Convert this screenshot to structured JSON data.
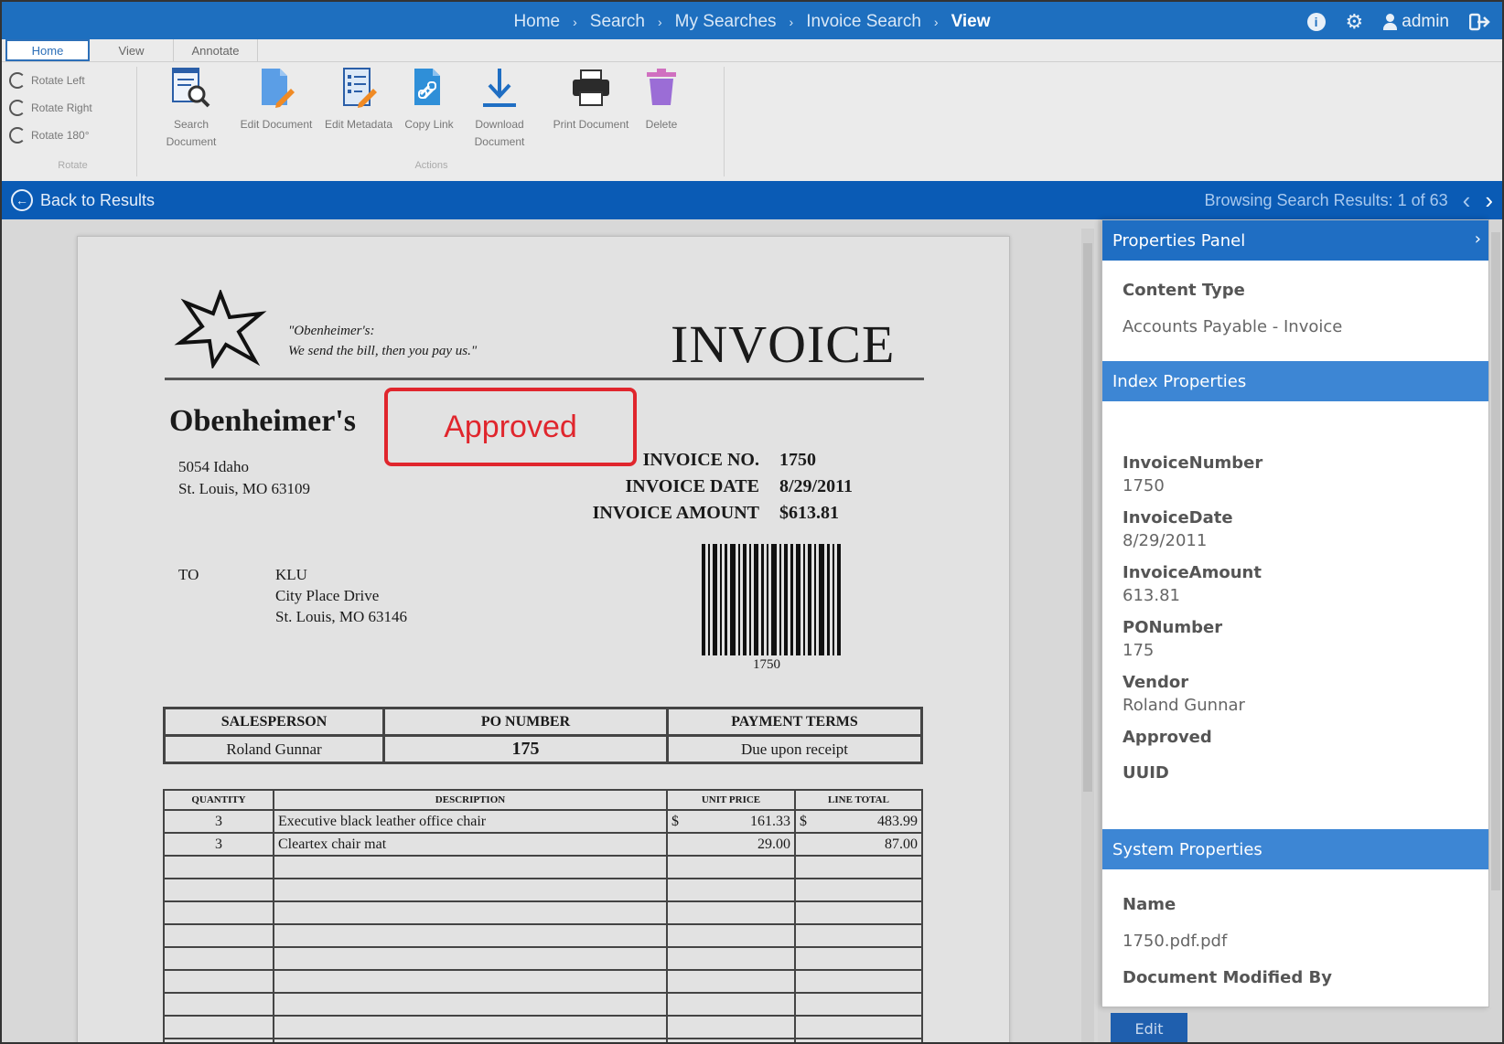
{
  "breadcrumbs": {
    "items": [
      "Home",
      "Search",
      "My Searches",
      "Invoice Search"
    ],
    "current": "View"
  },
  "topbar": {
    "user": "admin",
    "icons": [
      "info-icon",
      "gear-icon",
      "user-icon",
      "logout-icon"
    ]
  },
  "ribbon": {
    "tabs": [
      "Home",
      "View",
      "Annotate"
    ],
    "active_tab": "Home",
    "rotate": {
      "items": [
        "Rotate Left",
        "Rotate Right",
        "Rotate 180°"
      ],
      "label": "Rotate"
    },
    "actions": {
      "label": "Actions",
      "items": [
        {
          "line1": "Search",
          "line2": "Document"
        },
        {
          "line1": "Edit Document",
          "line2": ""
        },
        {
          "line1": "Edit Metadata",
          "line2": ""
        },
        {
          "line1": "Copy Link",
          "line2": ""
        },
        {
          "line1": "Download",
          "line2": "Document"
        },
        {
          "line1": "Print Document",
          "line2": ""
        },
        {
          "line1": "Delete",
          "line2": ""
        }
      ]
    }
  },
  "actionbar": {
    "back_label": "Back to Results",
    "browsing": "Browsing Search Results: 1 of 63"
  },
  "document": {
    "tagline_1": "\"Obenheimer's:",
    "tagline_2": "We send the bill, then you pay us.\"",
    "title": "INVOICE",
    "company": "Obenheimer's",
    "stamp": "Approved",
    "address_1": "5054 Idaho",
    "address_2": "St. Louis, MO  63109",
    "meta": [
      {
        "label": "INVOICE NO.",
        "value": "1750"
      },
      {
        "label": "INVOICE DATE",
        "value": "8/29/2011"
      },
      {
        "label": "INVOICE AMOUNT",
        "value": "$613.81"
      }
    ],
    "to_label": "TO",
    "to_1": "KLU",
    "to_2": "City Place Drive",
    "to_3": "St. Louis, MO  63146",
    "barcode_number": "1750",
    "summary_headers": [
      "SALESPERSON",
      "PO NUMBER",
      "PAYMENT TERMS"
    ],
    "summary_values": [
      "Roland Gunnar",
      "175",
      "Due upon receipt"
    ],
    "line_headers": [
      "QUANTITY",
      "DESCRIPTION",
      "UNIT PRICE",
      "LINE TOTAL"
    ],
    "currency": "$",
    "lines": [
      {
        "qty": "3",
        "desc": "Executive black leather office chair",
        "unit": "161.33",
        "total": "483.99"
      },
      {
        "qty": "3",
        "desc": "Cleartex chair mat",
        "unit": "29.00",
        "total": "87.00"
      }
    ]
  },
  "panel": {
    "title": "Properties Panel",
    "content_type_label": "Content Type",
    "content_type_value": "Accounts Payable - Invoice",
    "index_header": "Index Properties",
    "invoice_number_label": "InvoiceNumber",
    "invoice_number_value": "1750",
    "invoice_date_label": "InvoiceDate",
    "invoice_date_value": "8/29/2011",
    "invoice_amount_label": "InvoiceAmount",
    "invoice_amount_value": "613.81",
    "po_number_label": "PONumber",
    "po_number_value": "175",
    "vendor_label": "Vendor",
    "vendor_value": "Roland Gunnar",
    "approved_label": "Approved",
    "uuid_label": "UUID",
    "system_header": "System Properties",
    "name_label": "Name",
    "name_value": "1750.pdf.pdf",
    "modified_by_label": "Document Modified By",
    "edit_button": "Edit"
  },
  "colors": {
    "topbar": "#1e6fbf",
    "actionbar": "#0a5bb5",
    "panel_header": "#3d86d4",
    "stamp": "#e0262d"
  }
}
